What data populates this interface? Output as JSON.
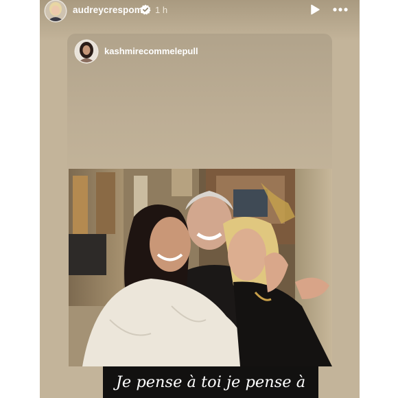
{
  "story": {
    "username": "audreycrespom",
    "verified": true,
    "time": "1 h",
    "controls": {
      "play_icon": "play-icon",
      "more_icon": "more-options-icon"
    }
  },
  "repost": {
    "username": "kashmirecommelepull"
  },
  "photo": {
    "description_icon": "photo-of-three-people-hugging"
  },
  "caption": {
    "text": "Je pense à toi je pense à"
  },
  "colors": {
    "story_background": "#c3b49a",
    "caption_background": "#121110"
  }
}
